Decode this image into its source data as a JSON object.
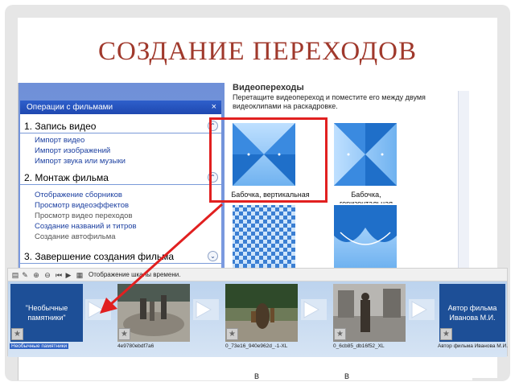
{
  "slide": {
    "title": "СОЗДАНИЕ ПЕРЕХОДОВ"
  },
  "task_pane": {
    "header": "Операции с фильмами",
    "close_label": "×",
    "sections": [
      {
        "title": "1. Запись видео",
        "toggle": "⌃",
        "links": [
          "Импорт видео",
          "Импорт изображений",
          "Импорт звука или музыки"
        ]
      },
      {
        "title": "2. Монтаж фильма",
        "toggle": "⌃",
        "links": [
          "Отображение сборников",
          "Просмотр видеоэффектов",
          "Просмотр видео переходов",
          "Создание названий и титров",
          "Создание автофильма"
        ]
      },
      {
        "title": "3. Завершение создания фильма",
        "toggle": "⌄",
        "links": []
      }
    ]
  },
  "transitions": {
    "title": "Видеопереходы",
    "description": "Перетащите видеопереход и поместите его между двумя видеоклипами на раскадровке.",
    "items": [
      {
        "label": "Бабочка, вертикальная",
        "selected": true
      },
      {
        "label": "Бабочка, горизонтальная",
        "selected": false
      },
      {
        "label": "",
        "selected": false
      },
      {
        "label": "",
        "selected": false
      }
    ],
    "partial_labels": [
      "В",
      "В"
    ]
  },
  "storyboard": {
    "toolbar_text": "Отображение шкалы времени.",
    "clips": [
      {
        "name": "Необычные памятники",
        "title_text": "\"Необычные памятники\"",
        "kind": "title"
      },
      {
        "name": "4e9780ebdf7a6",
        "kind": "photo"
      },
      {
        "name": "0_73e16_940e962d_-1-XL",
        "kind": "photo"
      },
      {
        "name": "0_6cb85_db16f52_XL",
        "kind": "photo"
      },
      {
        "name": "Автор фильма Иванова М.И.",
        "title_text": "Автор фильма Иванова М.И.",
        "kind": "title"
      }
    ]
  },
  "colors": {
    "title": "#a0392c",
    "highlight": "#e12020",
    "accent_blue": "#1d4f97"
  }
}
